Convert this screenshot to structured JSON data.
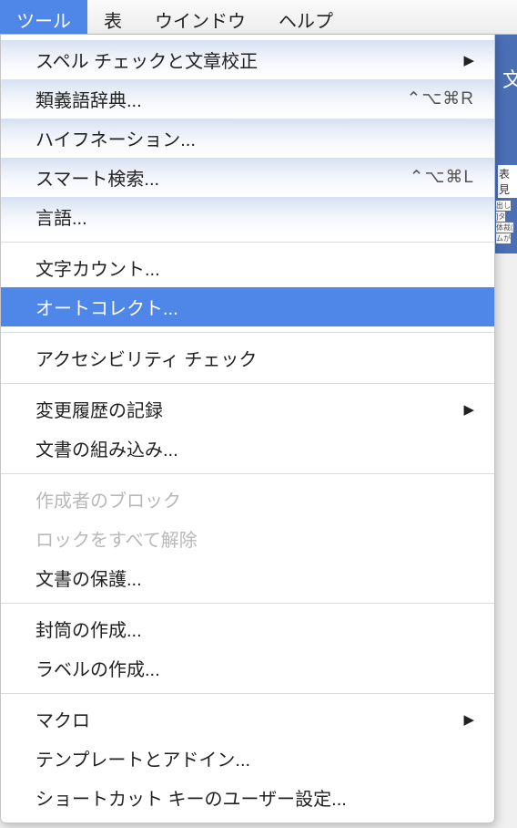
{
  "menubar": {
    "items": [
      {
        "label": "ツール",
        "active": true
      },
      {
        "label": "表",
        "active": false
      },
      {
        "label": "ウインドウ",
        "active": false
      },
      {
        "label": "ヘルプ",
        "active": false
      }
    ]
  },
  "dropdown": {
    "groups": [
      [
        {
          "label": "スペル チェックと文章校正",
          "submenu": true
        },
        {
          "label": "類義語辞典...",
          "shortcut": "⌃⌥⌘R"
        },
        {
          "label": "ハイフネーション..."
        },
        {
          "label": "スマート検索...",
          "shortcut": "⌃⌥⌘L"
        },
        {
          "label": "言語..."
        }
      ],
      [
        {
          "label": "文字カウント..."
        },
        {
          "label": "オートコレクト...",
          "highlighted": true
        }
      ],
      [
        {
          "label": "アクセシビリティ チェック"
        }
      ],
      [
        {
          "label": "変更履歴の記録",
          "submenu": true
        },
        {
          "label": "文書の組み込み..."
        }
      ],
      [
        {
          "label": "作成者のブロック",
          "disabled": true
        },
        {
          "label": "ロックをすべて解除",
          "disabled": true
        },
        {
          "label": "文書の保護..."
        }
      ],
      [
        {
          "label": "封筒の作成..."
        },
        {
          "label": "ラベルの作成..."
        }
      ],
      [
        {
          "label": "マクロ",
          "submenu": true
        },
        {
          "label": "テンプレートとアドイン..."
        },
        {
          "label": "ショートカット キーのユーザー設定..."
        }
      ]
    ]
  },
  "background": {
    "cutoff_char": "文",
    "side_label": "表見",
    "tiny1": "出し",
    "tiny2": "]タ",
    "tiny3": "体裁(",
    "tiny4": "ムが"
  }
}
